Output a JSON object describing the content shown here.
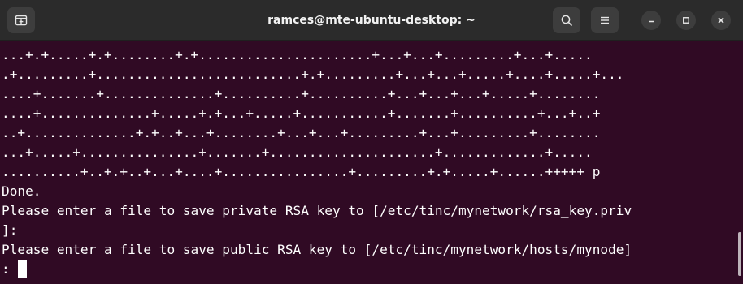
{
  "window": {
    "title": "ramces@mte-ubuntu-desktop: ~"
  },
  "icons": {
    "new_tab": "new-tab-icon",
    "search": "search-icon",
    "menu": "hamburger-menu-icon",
    "minimize": "minimize-icon",
    "maximize": "maximize-icon",
    "close": "close-icon"
  },
  "colors": {
    "terminal_bg": "#300a24",
    "titlebar_bg": "#2b2b2b",
    "text": "#ffffff"
  },
  "terminal": {
    "lines": [
      "...+.+.....+.+........+.+......................+...+...+.........+...+.....",
      ".+.........+..........................+.+.........+...+...+.....+....+.....+...",
      "....+.......+..............+..........+..........+...+...+...+.....+........",
      "....+..............+.....+.+...+.....+...........+.......+..........+...+..+",
      "..+..............+.+..+...+........+...+...+.........+...+.........+........",
      "...+.....+...............+.......+.....................+.............+.....",
      "..........+..+.+..+...+....+................+.........+.+.....+......+++++ p",
      "Done.",
      "Please enter a file to save private RSA key to [/etc/tinc/mynetwork/rsa_key.priv",
      "]:",
      "Please enter a file to save public RSA key to [/etc/tinc/mynetwork/hosts/mynode]",
      ":"
    ]
  }
}
